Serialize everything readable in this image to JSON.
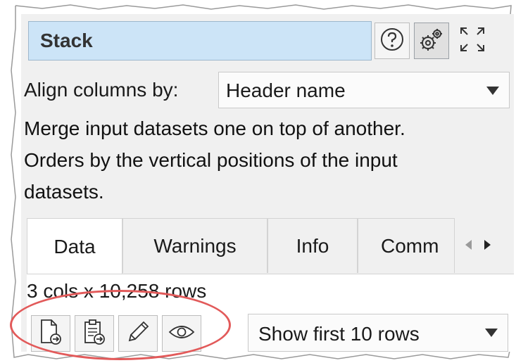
{
  "node": {
    "name": "Stack",
    "help_icon": "help-circle-icon",
    "settings_icon": "gears-icon",
    "maximize_icon": "maximize-arrows-icon"
  },
  "align": {
    "label": "Align columns by:",
    "selected": "Header name"
  },
  "description": {
    "line1": "Merge input datasets one on top of another.",
    "line2": "Orders by the vertical positions of the input",
    "line3": "datasets."
  },
  "tabs": [
    {
      "label": "Data",
      "active": true
    },
    {
      "label": "Warnings",
      "active": false
    },
    {
      "label": "Info",
      "active": false
    },
    {
      "label": "Comm",
      "active": false
    }
  ],
  "data": {
    "row_count": "3 cols x 10,258 rows",
    "rows_select": "Show first 10 rows",
    "toolbar_icons": [
      "file-output-icon",
      "clipboard-output-icon",
      "pencil-icon",
      "eye-icon"
    ]
  },
  "colors": {
    "name_field_bg": "#cce4f7",
    "panel_bg": "#f0f0f0",
    "highlight": "#e25a5a"
  }
}
